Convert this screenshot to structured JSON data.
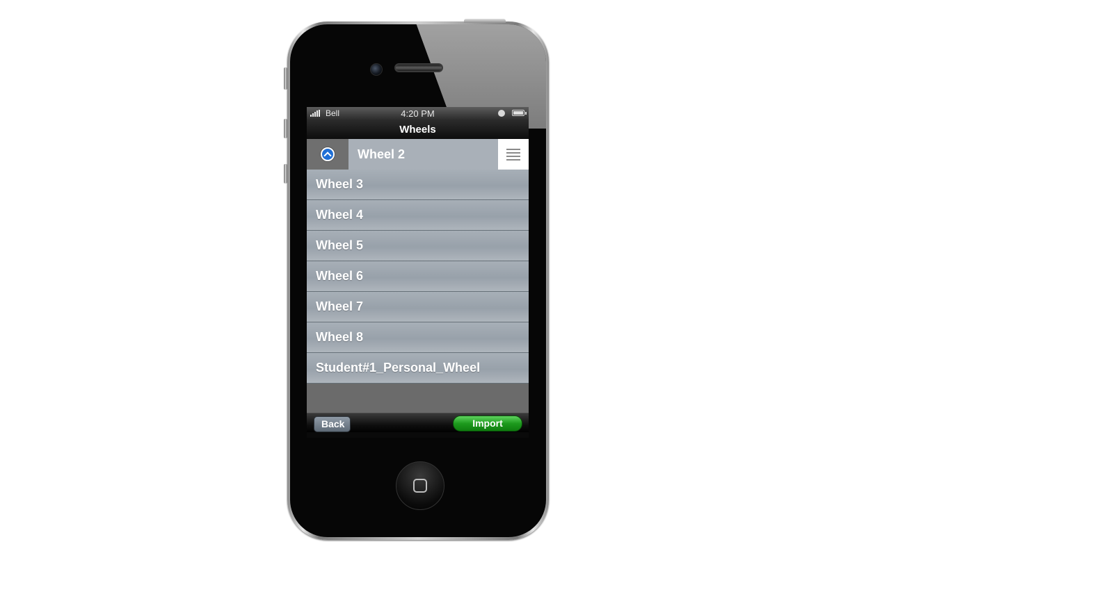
{
  "status_bar": {
    "carrier": "Bell",
    "time": "4:20 PM"
  },
  "nav": {
    "title": "Wheels"
  },
  "selected_row": {
    "label": "Wheel 2"
  },
  "list": {
    "items": [
      "Wheel 3",
      "Wheel 4",
      "Wheel 5",
      "Wheel 6",
      "Wheel 7",
      "Wheel 8",
      "Student#1_Personal_Wheel"
    ]
  },
  "toolbar": {
    "back_label": "Back",
    "import_label": "Import"
  },
  "colors": {
    "accent_blue": "#1f6fd6",
    "import_green": "#1d9a1d",
    "list_row": "#a1a9b1"
  },
  "icons": [
    "signal-icon",
    "lock-icon",
    "battery-icon",
    "chevron-up-icon",
    "menu-icon",
    "home-button-icon"
  ]
}
